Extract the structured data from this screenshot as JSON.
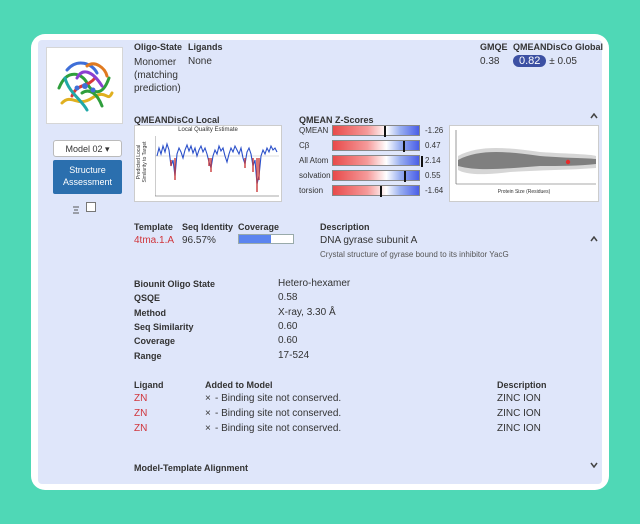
{
  "summary": {
    "oligo_state_label": "Oligo-State",
    "oligo_state_value_1": "Monomer",
    "oligo_state_value_2": "(matching",
    "oligo_state_value_3": "prediction)",
    "ligands_label": "Ligands",
    "ligands_value": "None",
    "gmqe_label": "GMQE",
    "gmqe_value": "0.38",
    "qmeandisco_global_label": "QMEANDisCo Global",
    "qmeandisco_global_value": "0.82",
    "qmeandisco_global_error": "± 0.05"
  },
  "model_menu": {
    "model_label": "Model 02",
    "assessment_label_1": "Structure",
    "assessment_label_2": "Assessment"
  },
  "local": {
    "heading": "QMEANDisCo Local",
    "plot_title": "Local Quality Estimate",
    "ylabel_1": "Predicted Local",
    "ylabel_2": "Similarity to Target"
  },
  "zscores": {
    "heading": "QMEAN Z-Scores",
    "rows": [
      {
        "label": "QMEAN",
        "value": "-1.26",
        "z": -1.26
      },
      {
        "label": "Cβ",
        "value": "0.47",
        "z": 0.47
      },
      {
        "label": "All Atom",
        "value": "2.14",
        "z": 2.14
      },
      {
        "label": "solvation",
        "value": "0.55",
        "z": 0.55
      },
      {
        "label": "torsion",
        "value": "-1.64",
        "z": -1.64
      }
    ],
    "scatter_xlabel": "Protein Size (Residues)"
  },
  "template": {
    "template_label": "Template",
    "template_value": "4tma.1.A",
    "seq_identity_label": "Seq Identity",
    "seq_identity_value": "96.57%",
    "coverage_label": "Coverage",
    "coverage_fraction": 0.6,
    "description_label": "Description",
    "description_value": "DNA gyrase subunit A",
    "description_sub": "Crystal structure of gyrase bound to its inhibitor YacG"
  },
  "details": [
    {
      "label": "Biounit Oligo State",
      "value": "Hetero-hexamer"
    },
    {
      "label": "QSQE",
      "value": "0.58"
    },
    {
      "label": "Method",
      "value": "X-ray, 3.30 Å"
    },
    {
      "label": "Seq Similarity",
      "value": "0.60"
    },
    {
      "label": "Coverage",
      "value": "0.60"
    },
    {
      "label": "Range",
      "value": "17-524"
    }
  ],
  "ligands": {
    "col_ligand": "Ligand",
    "col_added": "Added to Model",
    "col_description": "Description",
    "rows": [
      {
        "ligand": "ZN",
        "added_icon": "×",
        "added": "- Binding site not conserved.",
        "description": "ZINC ION"
      },
      {
        "ligand": "ZN",
        "added_icon": "×",
        "added": "- Binding site not conserved.",
        "description": "ZINC ION"
      },
      {
        "ligand": "ZN",
        "added_icon": "×",
        "added": "- Binding site not conserved.",
        "description": "ZINC ION"
      }
    ]
  },
  "alignment": {
    "heading": "Model-Template Alignment"
  },
  "colors": {
    "background": "#4fd8b6",
    "panel": "#dfe6fa",
    "accent_blue": "#2b6fae",
    "badge": "#3c50a3",
    "ligand_red": "#d0353b"
  }
}
